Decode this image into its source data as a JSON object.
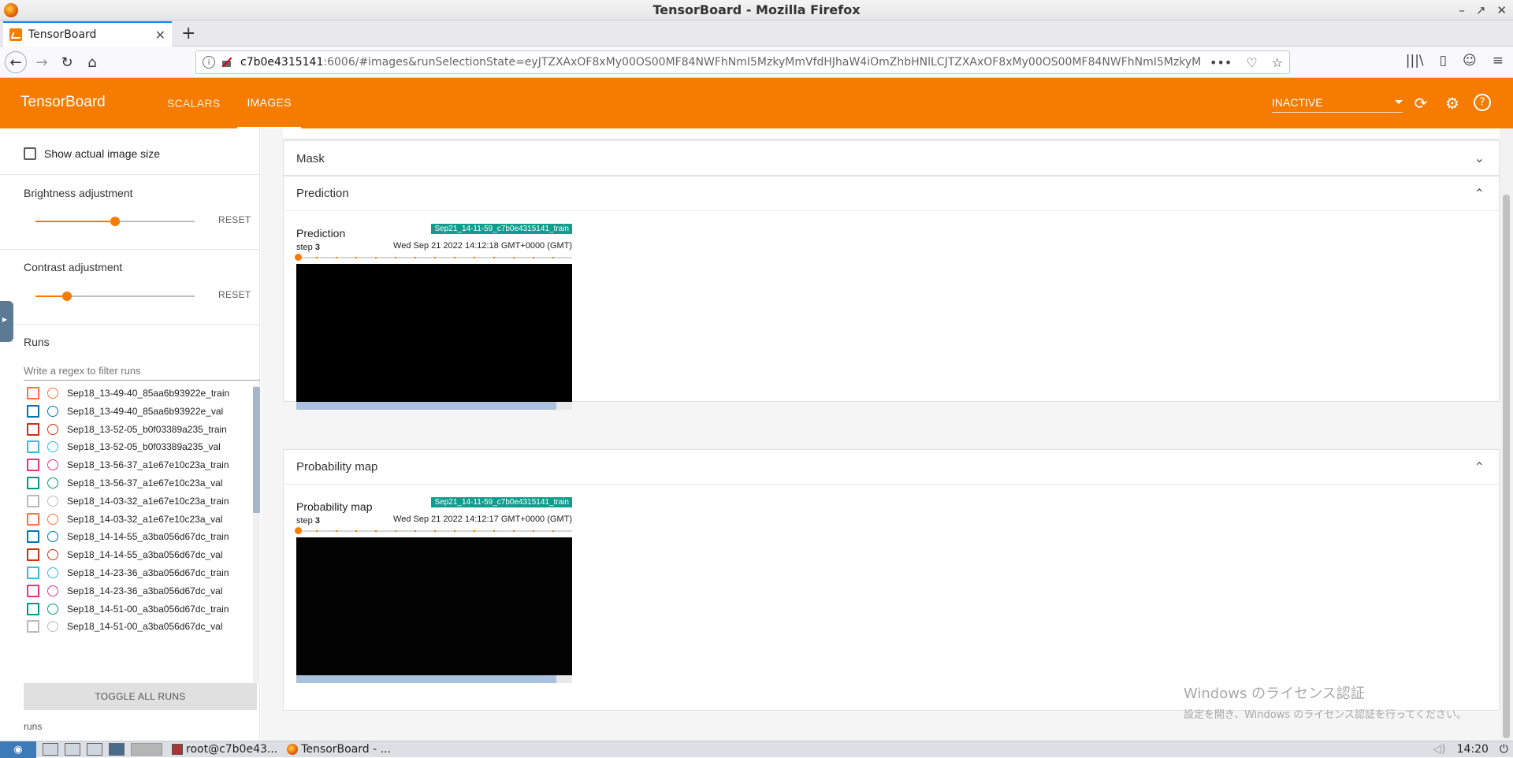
{
  "window": {
    "title": "TensorBoard - Mozilla Firefox",
    "controls": [
      "–",
      "↗",
      "✕"
    ]
  },
  "browser": {
    "tab_title": "TensorBoard",
    "tab_close": "✕",
    "new_tab": "+",
    "url_host": "c7b0e4315141",
    "url_rest": ":6006/#images&runSelectionState=eyJTZXAxOF8xMy00OS00MF84NWFhNmI5MzkyMmVfdHJhaW4iOmZhbHNlLCJTZXAxOF8xMy00OS00MF84NWFhNmI5MzkyMmVfd",
    "url_actions": [
      "•••",
      "♡",
      "☆"
    ],
    "right_icons": [
      "|||\\",
      "▯",
      "☺",
      "≡"
    ]
  },
  "header": {
    "brand": "TensorBoard",
    "tabs": [
      {
        "label": "SCALARS",
        "active": false
      },
      {
        "label": "IMAGES",
        "active": true
      }
    ],
    "status": "INACTIVE",
    "icons": [
      "refresh-icon",
      "settings-icon",
      "help-icon"
    ]
  },
  "sidebar": {
    "show_actual_size": "Show actual image size",
    "brightness": {
      "label": "Brightness adjustment",
      "level_fraction": 0.5,
      "reset": "RESET"
    },
    "contrast": {
      "label": "Contrast adjustment",
      "level_fraction": 0.2,
      "reset": "RESET"
    },
    "runs_title": "Runs",
    "filter_placeholder": "Write a regex to filter runs",
    "runs": [
      {
        "name": "Sep18_13-49-40_85aa6b93922e_train",
        "color": "#ff7043"
      },
      {
        "name": "Sep18_13-49-40_85aa6b93922e_val",
        "color": "#0077bb"
      },
      {
        "name": "Sep18_13-52-05_b0f03389a235_train",
        "color": "#cc3311"
      },
      {
        "name": "Sep18_13-52-05_b0f03389a235_val",
        "color": "#33bbee"
      },
      {
        "name": "Sep18_13-56-37_a1e67e10c23a_train",
        "color": "#ee3377"
      },
      {
        "name": "Sep18_13-56-37_a1e67e10c23a_val",
        "color": "#009988"
      },
      {
        "name": "Sep18_14-03-32_a1e67e10c23a_train",
        "color": "#bbbbbb"
      },
      {
        "name": "Sep18_14-03-32_a1e67e10c23a_val",
        "color": "#ff7043"
      },
      {
        "name": "Sep18_14-14-55_a3ba056d67dc_train",
        "color": "#0077bb"
      },
      {
        "name": "Sep18_14-14-55_a3ba056d67dc_val",
        "color": "#cc3311"
      },
      {
        "name": "Sep18_14-23-36_a3ba056d67dc_train",
        "color": "#33bbee"
      },
      {
        "name": "Sep18_14-23-36_a3ba056d67dc_val",
        "color": "#ee3377"
      },
      {
        "name": "Sep18_14-51-00_a3ba056d67dc_train",
        "color": "#009988"
      },
      {
        "name": "Sep18_14-51-00_a3ba056d67dc_val",
        "color": "#bbbbbb"
      }
    ],
    "toggle_all": "TOGGLE ALL RUNS",
    "footer": "runs"
  },
  "main": {
    "sections": [
      {
        "title": "Mask",
        "chevron": "⌄"
      },
      {
        "title": "Prediction",
        "chevron": "⌃",
        "card": {
          "title": "Prediction",
          "run": "Sep21_14-11-59_c7b0e4315141_train",
          "step_label": "step",
          "step": "3",
          "time": "Wed Sep 21 2022 14:12:18 GMT+0000 (GMT)"
        }
      },
      {
        "title": "Probability map",
        "chevron": "⌃",
        "card": {
          "title": "Probability map",
          "run": "Sep21_14-11-59_c7b0e4315141_train",
          "step_label": "step",
          "step": "3",
          "time": "Wed Sep 21 2022 14:12:17 GMT+0000 (GMT)"
        }
      }
    ],
    "watermark_line1": "Windows のライセンス認証",
    "watermark_line2": "設定を開き、Windows のライセンス認証を行ってください。"
  },
  "taskbar": {
    "tasks": [
      {
        "label": "root@c7b0e43..."
      },
      {
        "label": "TensorBoard - ..."
      }
    ],
    "clock": "14:20"
  }
}
